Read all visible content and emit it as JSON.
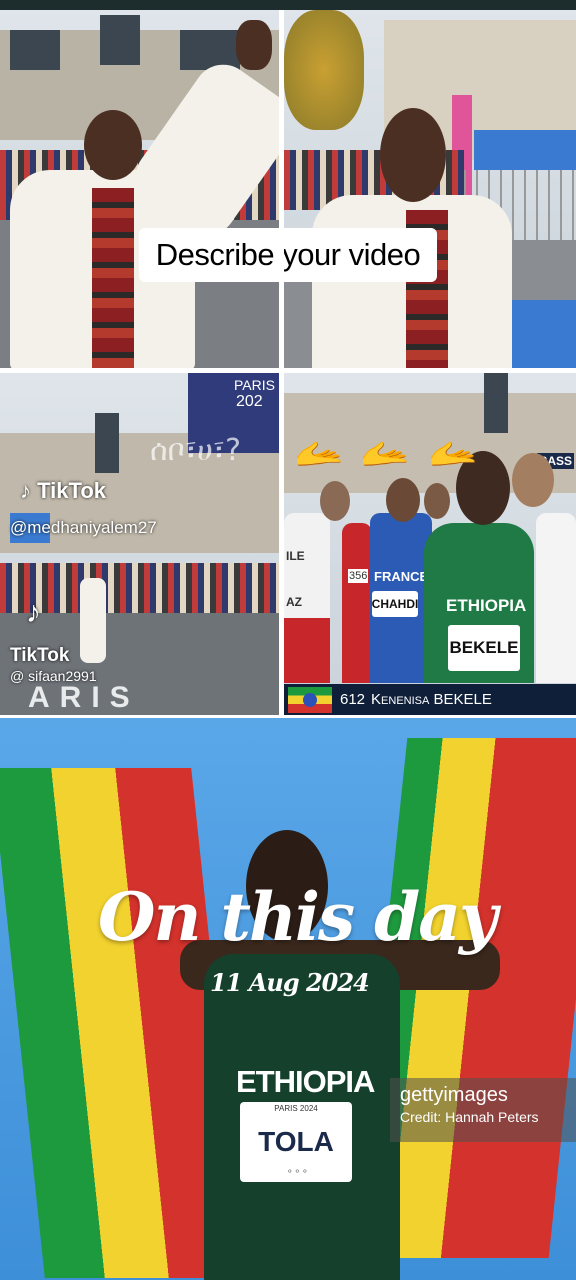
{
  "caption": {
    "text": "Describe your video"
  },
  "watermarks": {
    "tiktok_1": {
      "logo": "TikTok",
      "handle": "@medhaniyalem27"
    },
    "tiktok_2": {
      "logo": "TikTok",
      "handle": "@ sifaan2991"
    }
  },
  "paris_banner": {
    "line1": "PARIS",
    "line2": "202"
  },
  "tile3_overlay": {
    "amharic": "ሰቦ፣ሀ፣?"
  },
  "stage_text": "ARIS",
  "race_tile": {
    "emojis": [
      "🫴",
      "🫴",
      "🫴"
    ],
    "bibs": {
      "left": "FRANCE",
      "left_name": "CHAHDI",
      "main_country": "ETHIOPIA",
      "main_name": "BEKELE",
      "left_partial": "AZ",
      "left_partial2": "ILE",
      "num_partial": "356"
    },
    "lower_third": {
      "number": "612",
      "name": "Kenenisa BEKELE"
    },
    "corner_text": "RASS"
  },
  "bottom": {
    "headline": "On this day",
    "date": "11 Aug 2024",
    "jersey_country": "ETHIOPIA",
    "bib_event": "PARIS 2024",
    "bib_name": "TOLA",
    "getty_logo": "gettyimages",
    "getty_credit": "Credit: Hannah Peters"
  },
  "colors": {
    "eth_green": "#1e9a3e",
    "eth_yellow": "#f2d22e",
    "eth_red": "#d4322c",
    "sky_blue": "#4a9be0"
  }
}
